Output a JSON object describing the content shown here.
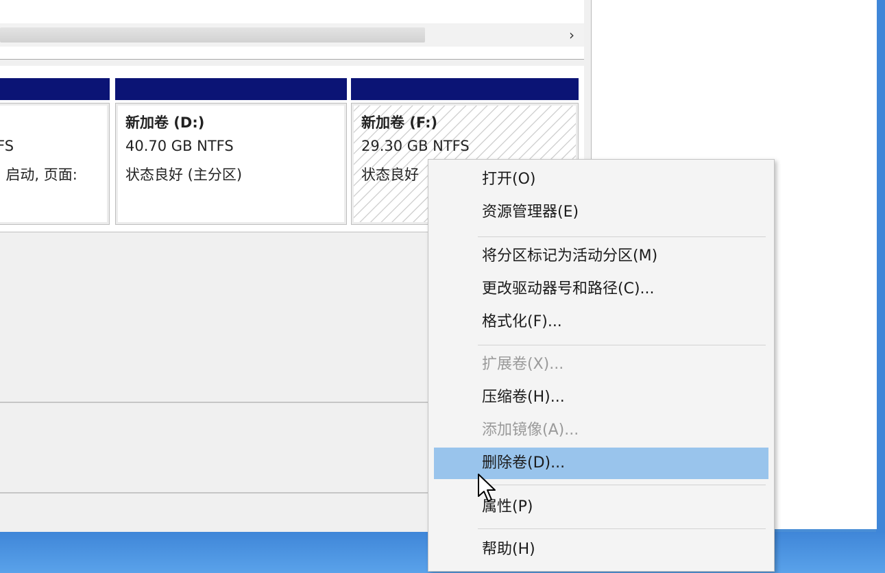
{
  "scroll": {
    "right_arrow_glyph": "›"
  },
  "partitions": [
    {
      "name": "",
      "size": "FS",
      "status": ", 启动, 页面:"
    },
    {
      "name": "新加卷  (D:)",
      "size": "40.70 GB NTFS",
      "status": "状态良好 (主分区)"
    },
    {
      "name": "新加卷  (F:)",
      "size": "29.30 GB NTFS",
      "status": "状态良好"
    }
  ],
  "context_menu": {
    "items": [
      {
        "label": "打开(O)",
        "enabled": true
      },
      {
        "label": "资源管理器(E)",
        "enabled": true
      },
      {
        "label": "将分区标记为活动分区(M)",
        "enabled": true
      },
      {
        "label": "更改驱动器号和路径(C)...",
        "enabled": true
      },
      {
        "label": "格式化(F)...",
        "enabled": true
      },
      {
        "label": "扩展卷(X)...",
        "enabled": false
      },
      {
        "label": "压缩卷(H)...",
        "enabled": true
      },
      {
        "label": "添加镜像(A)...",
        "enabled": false
      },
      {
        "label": "删除卷(D)...",
        "enabled": true,
        "highlighted": true
      },
      {
        "label": "属性(P)",
        "enabled": true
      },
      {
        "label": "帮助(H)",
        "enabled": true
      }
    ]
  },
  "colors": {
    "partition_bar": "#0b1475",
    "menu_highlight": "#99c4ec",
    "desktop": "#4a8ed6"
  }
}
